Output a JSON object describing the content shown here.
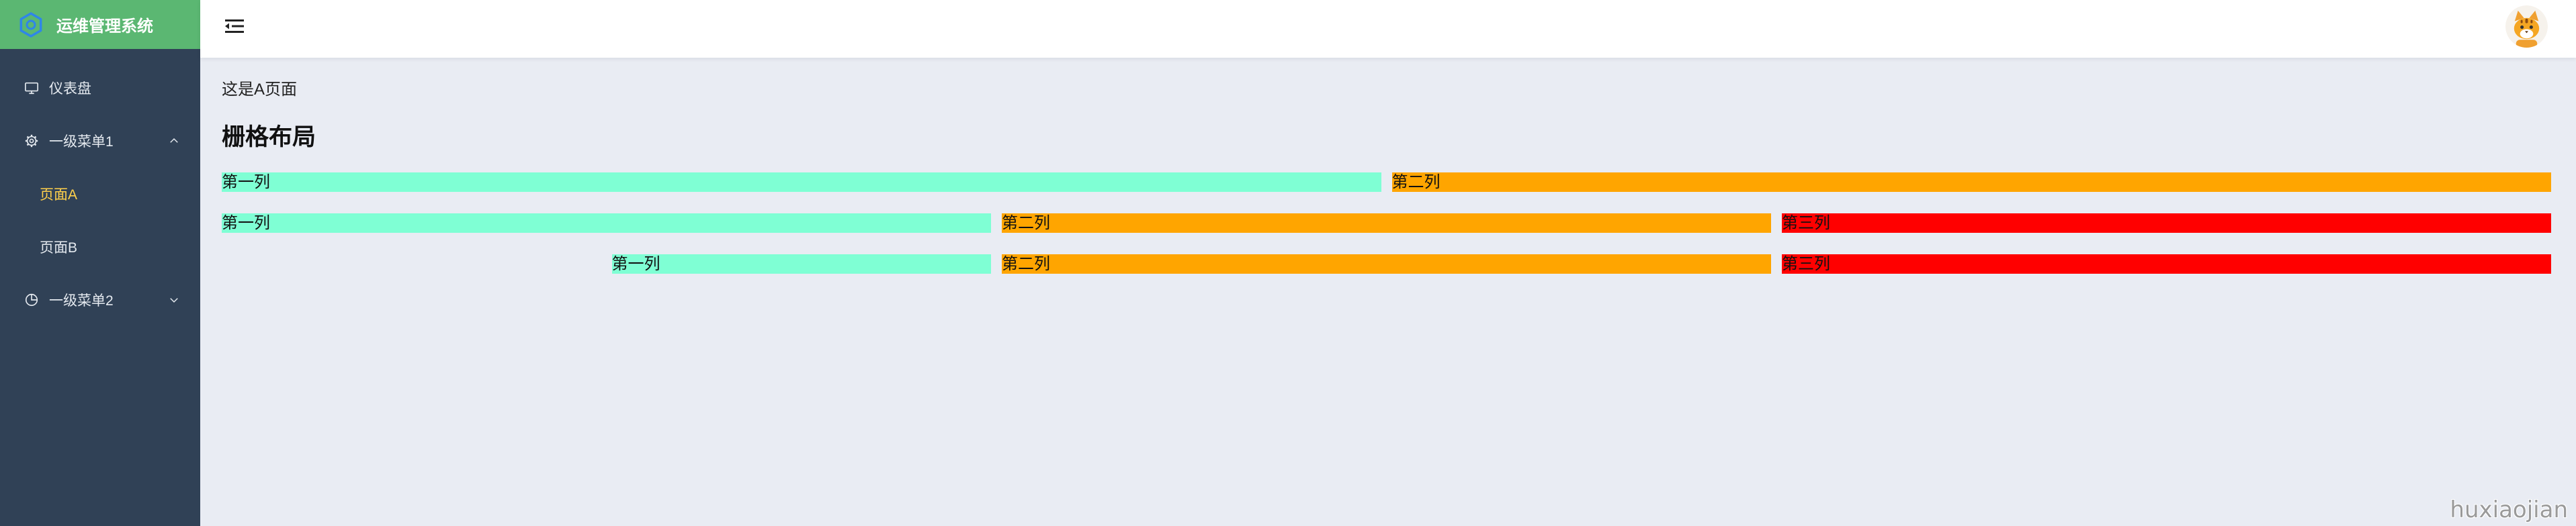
{
  "app": {
    "title": "运维管理系统",
    "logo_icon": "logo-icon"
  },
  "sidebar": {
    "items": [
      {
        "label": "仪表盘",
        "icon": "monitor-icon"
      },
      {
        "label": "一级菜单1",
        "icon": "setting-icon",
        "state_icon": "chevron-up-icon",
        "expanded": true,
        "children": [
          {
            "label": "页面A",
            "active": true
          },
          {
            "label": "页面B",
            "active": false
          }
        ]
      },
      {
        "label": "一级菜单2",
        "icon": "pie-chart-icon",
        "state_icon": "chevron-down-icon",
        "expanded": false
      }
    ]
  },
  "header": {
    "toggle_icon": "menu-fold-icon",
    "avatar_icon": "avatar-icon"
  },
  "page": {
    "intro": "这是A页面",
    "heading": "栅格布局",
    "rows": [
      {
        "cells": [
          {
            "label": "第一列",
            "color": "#7fffd4"
          },
          {
            "label": "第二列",
            "color": "#ffa500"
          }
        ]
      },
      {
        "cells": [
          {
            "label": "第一列",
            "color": "#7fffd4"
          },
          {
            "label": "第二列",
            "color": "#ffa500"
          },
          {
            "label": "第三列",
            "color": "#ff0000"
          }
        ]
      },
      {
        "cells": [
          {
            "label": "第一列",
            "color": "#7fffd4"
          },
          {
            "label": "第二列",
            "color": "#ffa500"
          },
          {
            "label": "第三列",
            "color": "#ff0000"
          }
        ]
      }
    ]
  },
  "watermark": "huxiaojian",
  "theme": {
    "brand": "#5bb772",
    "sidebar_bg": "#304156",
    "sidebar_text": "#e4e9ef",
    "active_text": "#ffd04b",
    "content_bg": "#e9ecf3",
    "header_bg": "#ffffff"
  }
}
